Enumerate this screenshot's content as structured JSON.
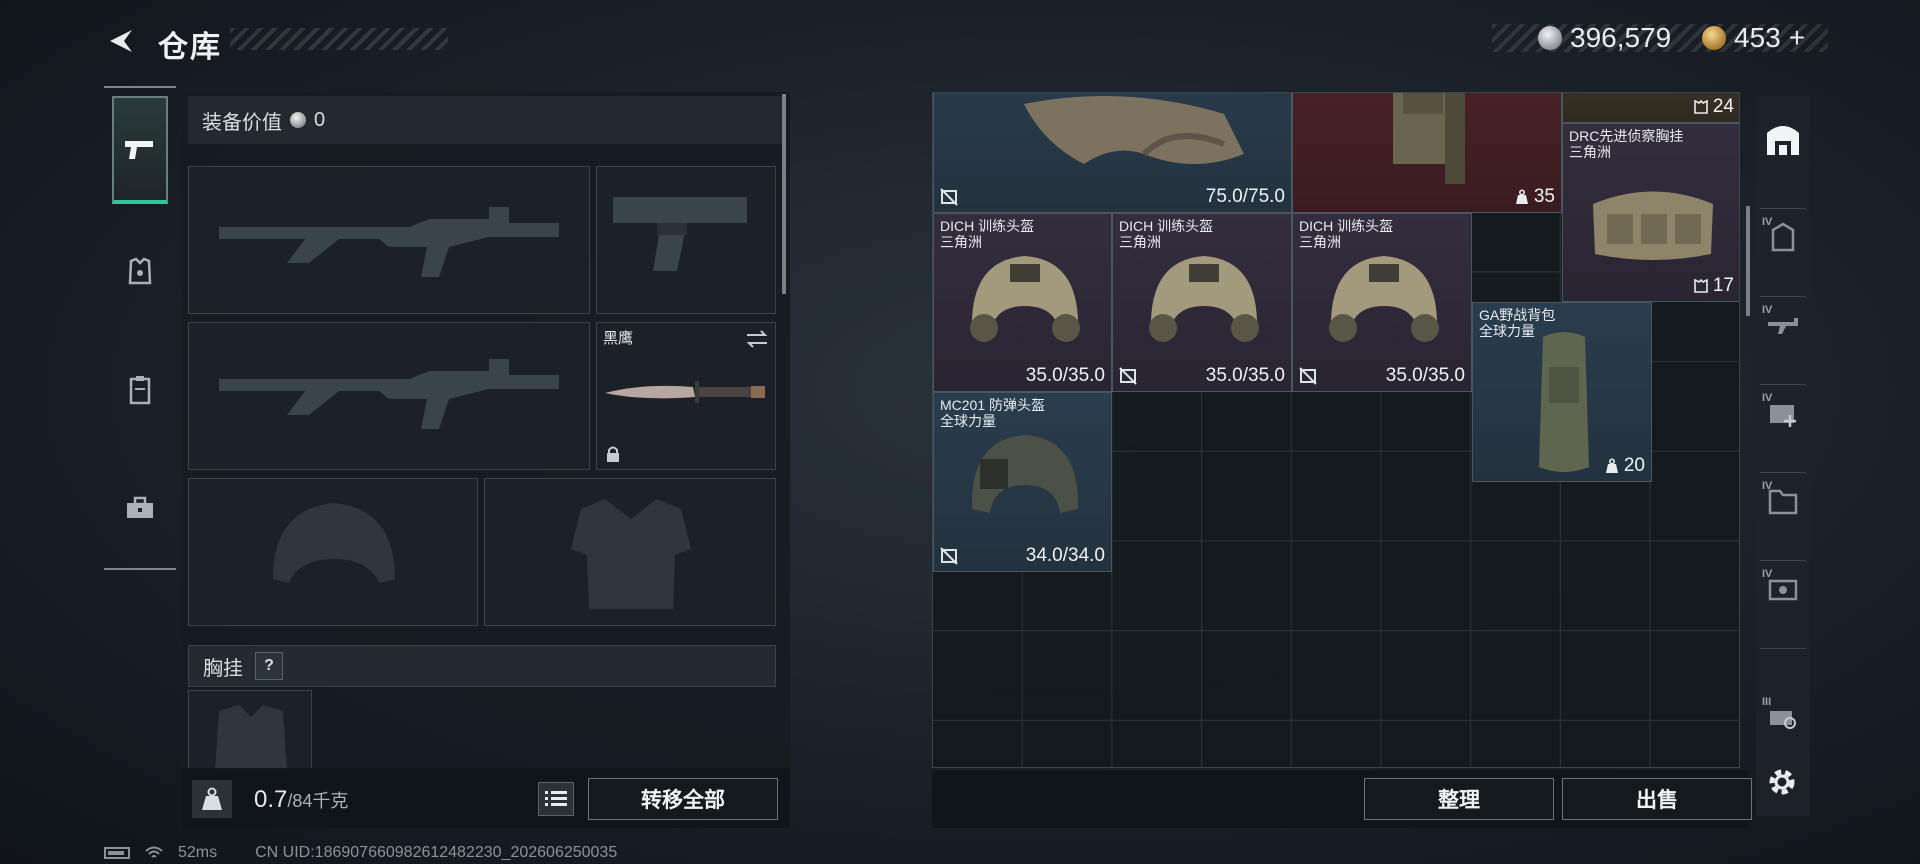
{
  "header": {
    "title": "仓库",
    "currency_silver": "396,579",
    "currency_gold": "453",
    "gold_plus": "+"
  },
  "equipment": {
    "value_label": "装备价值",
    "value": "0",
    "melee_name": "黑鹰",
    "backpack_label": "胸挂",
    "backpack_help": "?",
    "weight_value": "0.7",
    "weight_max": "/84千克",
    "transfer_all": "转移全部"
  },
  "stash": {
    "items": [
      {
        "id": "armor-top",
        "value": "75.0/75.0"
      },
      {
        "id": "rig-top",
        "count": "35"
      },
      {
        "id": "count24",
        "count": "24"
      },
      {
        "id": "drc",
        "name": "DRC先进侦察胸挂",
        "maker": "三角洲",
        "count": "17"
      },
      {
        "id": "dich1",
        "name": "DICH 训练头盔",
        "maker": "三角洲",
        "value": "35.0/35.0"
      },
      {
        "id": "dich2",
        "name": "DICH 训练头盔",
        "maker": "三角洲",
        "value": "35.0/35.0"
      },
      {
        "id": "dich3",
        "name": "DICH 训练头盔",
        "maker": "三角洲",
        "value": "35.0/35.0"
      },
      {
        "id": "ga",
        "name": "GA野战背包",
        "maker": "全球力量",
        "count": "20"
      },
      {
        "id": "mc201",
        "name": "MC201 防弹头盔",
        "maker": "全球力量",
        "value": "34.0/34.0"
      }
    ],
    "sort_button": "整理",
    "sell_button": "出售"
  },
  "status": {
    "ping": "52ms",
    "uid": "CN UID:186907660982612482230_202606250035"
  },
  "colors": {
    "accent_green": "#2fc79b",
    "rarity_blue": "#2a3d4e",
    "rarity_red": "#4a2226",
    "rarity_purple": "#332d3d"
  },
  "icons": {
    "left_nav": [
      "pistol-icon",
      "armor-icon",
      "vest-icon",
      "toolbox-icon"
    ],
    "right_nav": [
      "stash-icon",
      "tier4-bag-icon",
      "tier4-gun-icon",
      "tier4-medkit-icon",
      "tier4-folder-icon",
      "tier4-box-icon",
      "tier3-gear-icon",
      "settings-icon"
    ]
  }
}
